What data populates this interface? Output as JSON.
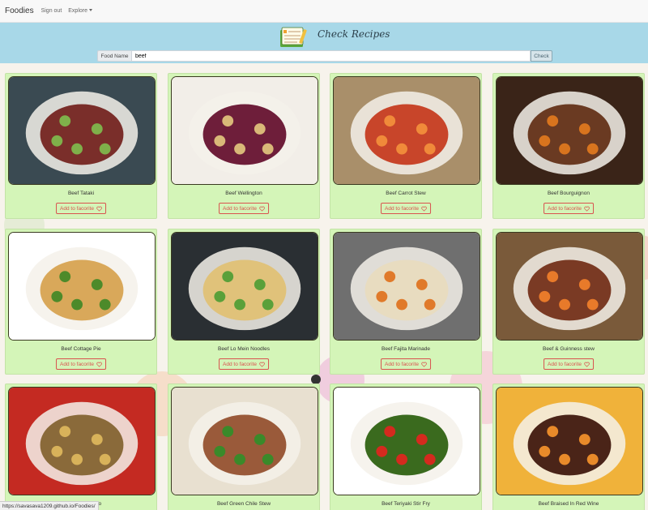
{
  "navbar": {
    "brand": "Foodies",
    "sign_out": "Sign out",
    "explore": "Explore"
  },
  "header": {
    "title": "Check Recipes",
    "food_label": "Food Name",
    "food_value": "beef",
    "check_label": "Check"
  },
  "favorite_label": "Add to facorite",
  "recipes": [
    {
      "name": "Beef Tataki",
      "plate": "#3a4a52",
      "food": "#7a2e2a",
      "accent": "#7fb04a"
    },
    {
      "name": "Beef Wellington",
      "plate": "#f2eee8",
      "food": "#6e1e3a",
      "accent": "#d9b878"
    },
    {
      "name": "Beef Carrot Stew",
      "plate": "#a98f6a",
      "food": "#c8452a",
      "accent": "#f08a3a"
    },
    {
      "name": "Beef Bourguignon",
      "plate": "#3a2418",
      "food": "#6a3a22",
      "accent": "#d8741e"
    },
    {
      "name": "Beef Cottage Pie",
      "plate": "#ffffff",
      "food": "#d9a85a",
      "accent": "#4d8a2a"
    },
    {
      "name": "Beef Lo Mein Noodles",
      "plate": "#2a2f33",
      "food": "#e0c27a",
      "accent": "#5aa03a"
    },
    {
      "name": "Beef Fajita Marinade",
      "plate": "#6f6f6f",
      "food": "#e8dcc0",
      "accent": "#e07a2a"
    },
    {
      "name": "Beef & Guinness stew",
      "plate": "#7a5a3a",
      "food": "#7a3a24",
      "accent": "#e87a2a"
    },
    {
      "name": "Beef Osso Bucco",
      "plate": "#c42a22",
      "food": "#8a6a3a",
      "accent": "#d8b25a"
    },
    {
      "name": "Beef Green Chile Stew",
      "plate": "#e8e0d0",
      "food": "#9a5a3a",
      "accent": "#3a8a2a"
    },
    {
      "name": "Beef Teriyaki Stir Fry",
      "plate": "#ffffff",
      "food": "#3a6a1e",
      "accent": "#d42a1e"
    },
    {
      "name": "Beef Braised In Red Wine",
      "plate": "#f0b23a",
      "food": "#4a2418",
      "accent": "#e88a2a"
    }
  ],
  "status_url": "https://savasava1209.github.io/Foodies/"
}
